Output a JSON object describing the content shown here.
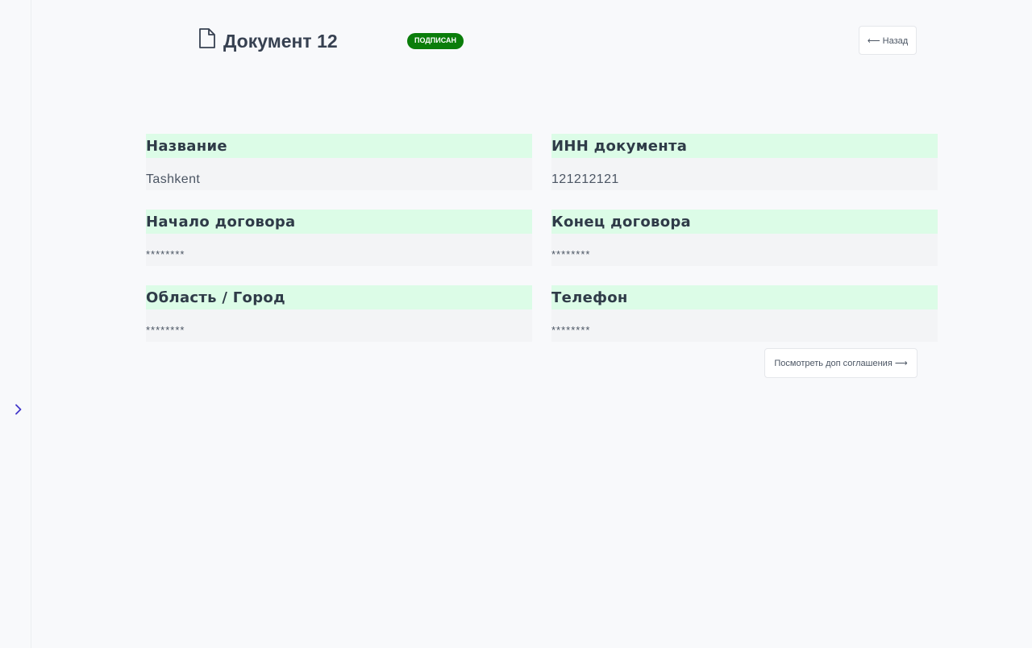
{
  "header": {
    "icon": "document-icon",
    "title": "Документ 12",
    "status": "ПОДПИСАН",
    "status_color": "#0a7d0a",
    "back_label": "⟵ Назад"
  },
  "sidebar": {
    "toggle_icon": "chevron-right-icon",
    "accent_color": "#4338ca"
  },
  "fields": [
    {
      "label": "Название",
      "value": "Tashkent"
    },
    {
      "label": "ИНН документа",
      "value": "121212121"
    },
    {
      "label": "Начало договора",
      "value": "********"
    },
    {
      "label": "Конец договора",
      "value": "********"
    },
    {
      "label": "Область / Город",
      "value": "********"
    },
    {
      "label": "Телефон",
      "value": "********"
    }
  ],
  "actions": {
    "more_label": "Посмотреть доп соглашения ⟶"
  },
  "colors": {
    "label_bg": "#dcfce7",
    "value_bg": "#f3f4f6",
    "page_bg": "#f8f9fb"
  }
}
